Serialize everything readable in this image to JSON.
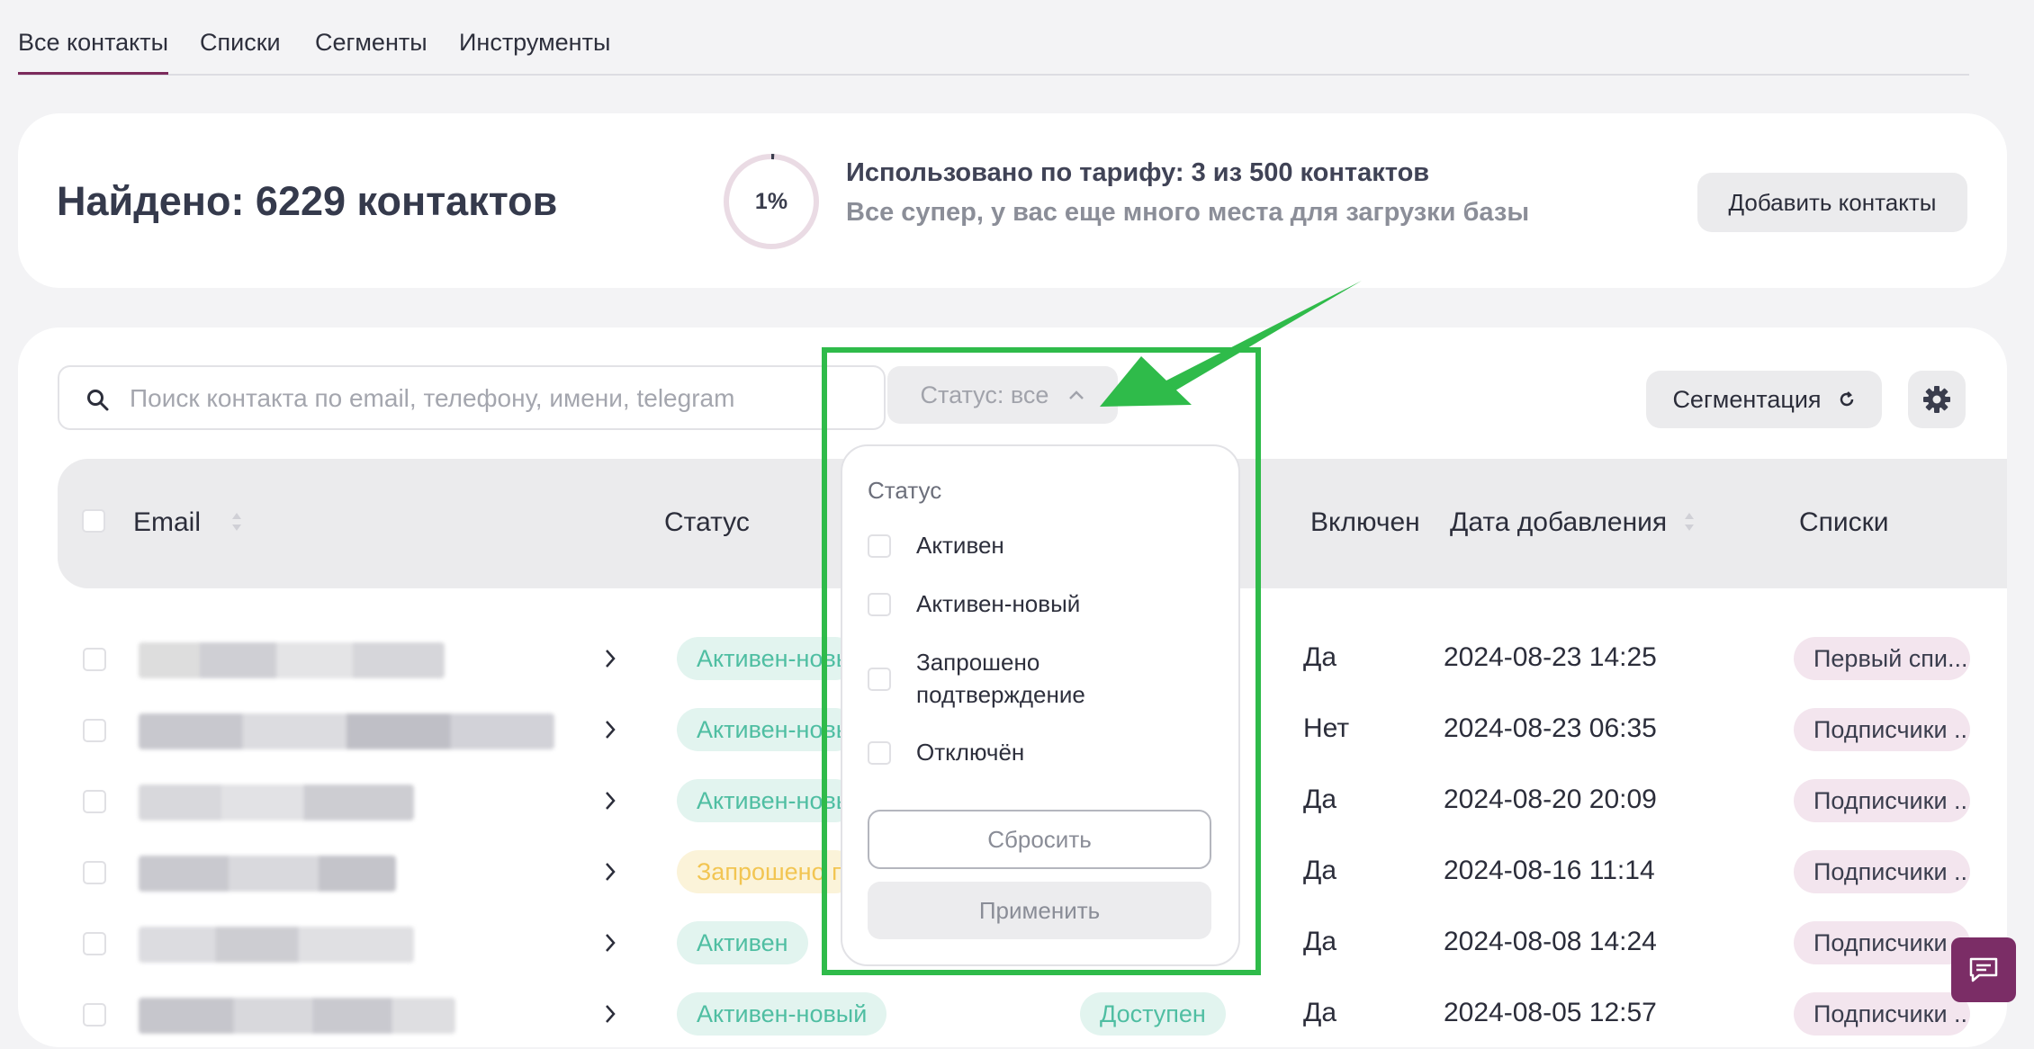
{
  "tabs": [
    "Все контакты",
    "Списки",
    "Сегменты",
    "Инструменты"
  ],
  "summary": {
    "found": "Найдено: 6229 контактов",
    "usage_percent_label": "1%",
    "usage_fraction": 0.01,
    "usage_line1": "Использовано по тарифу: 3 из 500 контактов",
    "usage_line2": "Все супер, у вас еще много места для загрузки базы",
    "add_button": "Добавить контакты"
  },
  "toolbar": {
    "search_placeholder": "Поиск контакта по email, телефону, имени, telegram",
    "status_button": "Статус: все",
    "segmentation_button": "Сегментация"
  },
  "table": {
    "headers": {
      "email": "Email",
      "status": "Статус",
      "enabled": "Включен",
      "date_added": "Дата добавления",
      "lists": "Списки"
    },
    "rows": [
      {
        "status": "Активен-новый",
        "status_type": "green",
        "enabled": "Да",
        "date": "2024-08-23 14:25",
        "list": "Первый спи..."
      },
      {
        "status": "Активен-новый",
        "status_type": "green",
        "enabled": "Нет",
        "date": "2024-08-23 06:35",
        "list": "Подписчики ..."
      },
      {
        "status": "Активен-новый",
        "status_type": "green",
        "enabled": "Да",
        "date": "2024-08-20 20:09",
        "list": "Подписчики ..."
      },
      {
        "status": "Запрошено подтверждение",
        "status_type": "yellow",
        "enabled": "Да",
        "date": "2024-08-16 11:14",
        "list": "Подписчики ..."
      },
      {
        "status": "Активен",
        "status_type": "green",
        "enabled": "Да",
        "date": "2024-08-08 14:24",
        "list": "Подписчики ..."
      },
      {
        "status": "Активен-новый",
        "status_type": "green",
        "availability": "Доступен",
        "enabled": "Да",
        "date": "2024-08-05 12:57",
        "list": "Подписчики ..."
      }
    ]
  },
  "status_dropdown": {
    "title": "Статус",
    "options": [
      "Активен",
      "Активен-новый",
      "Запрошено подтверждение",
      "Отключён"
    ],
    "reset": "Сбросить",
    "apply": "Применить"
  },
  "colors": {
    "accent": "#7b2a5b",
    "highlight": "#2fbb4a",
    "status_green_text": "#4fbea2",
    "status_yellow_text": "#f2c552",
    "list_pill_bg": "#f3e5ee"
  }
}
